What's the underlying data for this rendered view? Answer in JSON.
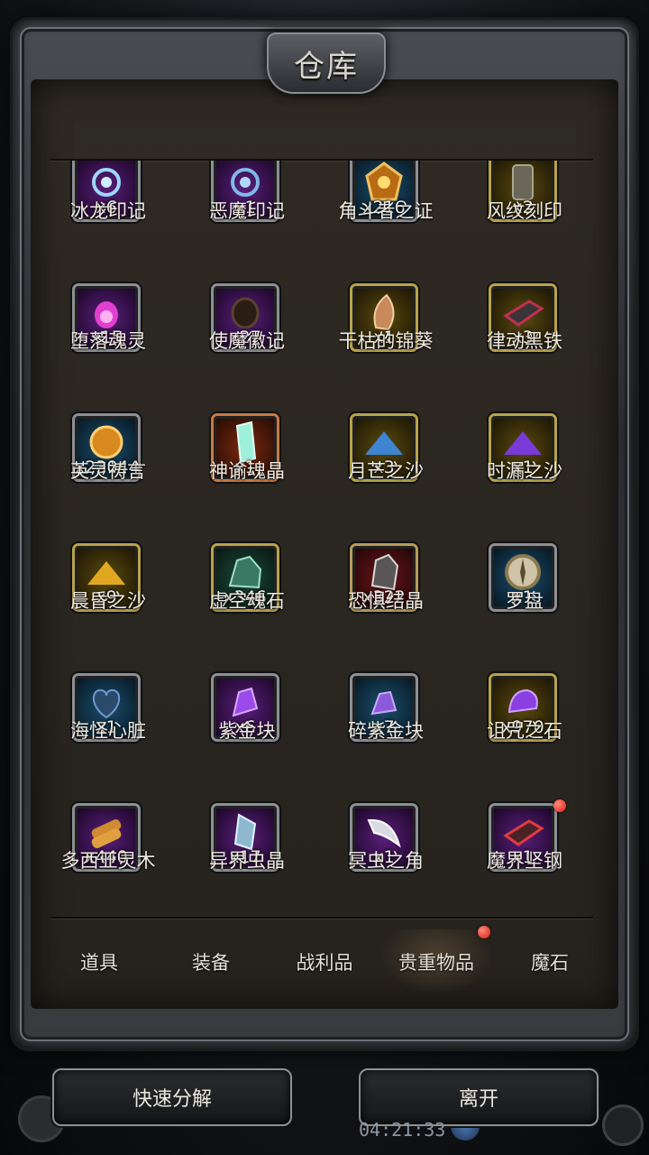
{
  "window": {
    "title": "仓库"
  },
  "items": [
    {
      "name": "冰龙印记",
      "qty": "x6",
      "rarity": "purple",
      "icon": "ice-swirl-icon"
    },
    {
      "name": "恶魔印记",
      "qty": "x1",
      "rarity": "purple",
      "icon": "demon-swirl-icon"
    },
    {
      "name": "角斗者之证",
      "qty": "x216",
      "rarity": "blue",
      "icon": "gladiator-emblem-icon"
    },
    {
      "name": "风纹刻印",
      "qty": "x2",
      "rarity": "gold",
      "icon": "wind-rune-icon"
    },
    {
      "name": "堕落魂灵",
      "qty": "x15",
      "rarity": "purple",
      "icon": "fallen-soul-icon"
    },
    {
      "name": "使魔徽记",
      "qty": "x27",
      "rarity": "purple",
      "icon": "familiar-badge-icon"
    },
    {
      "name": "干枯的锦葵",
      "qty": "x1",
      "rarity": "gold",
      "icon": "withered-mallow-icon"
    },
    {
      "name": "律动黑铁",
      "qty": "x3",
      "rarity": "gold",
      "icon": "black-iron-icon"
    },
    {
      "name": "英灵祷言",
      "qty": "x23044",
      "rarity": "blue",
      "icon": "hero-prayer-orb-icon"
    },
    {
      "name": "神谕魂晶",
      "qty": "x1",
      "rarity": "orange",
      "icon": "oracle-crystal-icon"
    },
    {
      "name": "月芒之沙",
      "qty": "x3",
      "rarity": "gold",
      "icon": "moon-sand-icon"
    },
    {
      "name": "时漏之沙",
      "qty": "x1",
      "rarity": "gold",
      "icon": "time-sand-icon"
    },
    {
      "name": "晨昏之沙",
      "qty": "x9",
      "rarity": "gold",
      "icon": "dusk-sand-icon"
    },
    {
      "name": "虚空魂石",
      "qty": "x346",
      "rarity": "teal",
      "icon": "void-soulstone-icon"
    },
    {
      "name": "恐惧结晶",
      "qty": "x322",
      "rarity": "red",
      "icon": "fear-crystal-icon"
    },
    {
      "name": "罗盘",
      "qty": "x1",
      "rarity": "blue",
      "icon": "compass-icon"
    },
    {
      "name": "海怪心脏",
      "qty": "x1",
      "rarity": "blue",
      "icon": "sea-monster-heart-icon"
    },
    {
      "name": "紫金块",
      "qty": "x6",
      "rarity": "purple",
      "icon": "purple-gold-icon"
    },
    {
      "name": "碎紫金块",
      "qty": "x7",
      "rarity": "blue",
      "icon": "purple-gold-shard-icon"
    },
    {
      "name": "诅咒之石",
      "qty": "x970",
      "rarity": "gold",
      "icon": "curse-stone-icon"
    },
    {
      "name": "多西亚灵木",
      "qty": "x440",
      "rarity": "purple",
      "icon": "spirit-wood-icon"
    },
    {
      "name": "异界虫晶",
      "qty": "x17",
      "rarity": "purple",
      "icon": "insect-crystal-icon"
    },
    {
      "name": "冥虫之角",
      "qty": "x1",
      "rarity": "purple",
      "icon": "underworld-horn-icon"
    },
    {
      "name": "魔界坚钢",
      "qty": "x1",
      "rarity": "purple",
      "icon": "demon-steel-icon",
      "badge": true
    }
  ],
  "tabs": [
    {
      "label": "道具"
    },
    {
      "label": "装备"
    },
    {
      "label": "战利品"
    },
    {
      "label": "贵重物品",
      "active": true,
      "badge": true
    },
    {
      "label": "魔石"
    }
  ],
  "buttons": {
    "decompose": "快速分解",
    "leave": "离开"
  },
  "status": {
    "clock": "04:21:33"
  },
  "colors": {
    "badge": "#e0241a",
    "frame": "#8d9095",
    "panel": "#2a2620"
  }
}
